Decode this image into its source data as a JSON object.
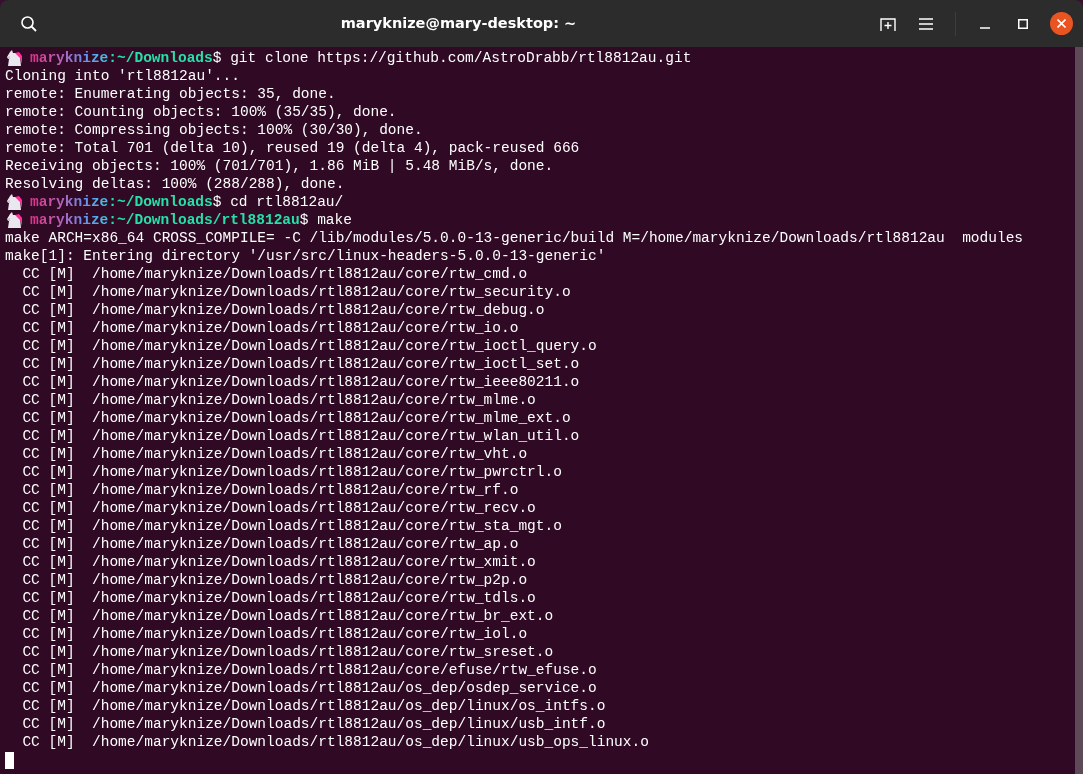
{
  "window": {
    "title": "maryknize@mary-desktop: ~"
  },
  "lines": [
    {
      "kind": "prompt",
      "user": "maryknize",
      "path": ":~/Downloads",
      "command": "$ git clone https://github.com/AstroDrabb/rtl8812au.git"
    },
    {
      "kind": "output",
      "text": "Cloning into 'rtl8812au'..."
    },
    {
      "kind": "output",
      "text": "remote: Enumerating objects: 35, done."
    },
    {
      "kind": "output",
      "text": "remote: Counting objects: 100% (35/35), done."
    },
    {
      "kind": "output",
      "text": "remote: Compressing objects: 100% (30/30), done."
    },
    {
      "kind": "output",
      "text": "remote: Total 701 (delta 10), reused 19 (delta 4), pack-reused 666"
    },
    {
      "kind": "output",
      "text": "Receiving objects: 100% (701/701), 1.86 MiB | 5.48 MiB/s, done."
    },
    {
      "kind": "output",
      "text": "Resolving deltas: 100% (288/288), done."
    },
    {
      "kind": "prompt",
      "user": "maryknize",
      "path": ":~/Downloads",
      "command": "$ cd rtl8812au/"
    },
    {
      "kind": "prompt",
      "user": "maryknize",
      "path": ":~/Downloads/rtl8812au",
      "command": "$ make"
    },
    {
      "kind": "output",
      "text": "make ARCH=x86_64 CROSS_COMPILE= -C /lib/modules/5.0.0-13-generic/build M=/home/maryknize/Downloads/rtl8812au  modules"
    },
    {
      "kind": "output",
      "text": "make[1]: Entering directory '/usr/src/linux-headers-5.0.0-13-generic'"
    },
    {
      "kind": "output",
      "text": "  CC [M]  /home/maryknize/Downloads/rtl8812au/core/rtw_cmd.o"
    },
    {
      "kind": "output",
      "text": "  CC [M]  /home/maryknize/Downloads/rtl8812au/core/rtw_security.o"
    },
    {
      "kind": "output",
      "text": "  CC [M]  /home/maryknize/Downloads/rtl8812au/core/rtw_debug.o"
    },
    {
      "kind": "output",
      "text": "  CC [M]  /home/maryknize/Downloads/rtl8812au/core/rtw_io.o"
    },
    {
      "kind": "output",
      "text": "  CC [M]  /home/maryknize/Downloads/rtl8812au/core/rtw_ioctl_query.o"
    },
    {
      "kind": "output",
      "text": "  CC [M]  /home/maryknize/Downloads/rtl8812au/core/rtw_ioctl_set.o"
    },
    {
      "kind": "output",
      "text": "  CC [M]  /home/maryknize/Downloads/rtl8812au/core/rtw_ieee80211.o"
    },
    {
      "kind": "output",
      "text": "  CC [M]  /home/maryknize/Downloads/rtl8812au/core/rtw_mlme.o"
    },
    {
      "kind": "output",
      "text": "  CC [M]  /home/maryknize/Downloads/rtl8812au/core/rtw_mlme_ext.o"
    },
    {
      "kind": "output",
      "text": "  CC [M]  /home/maryknize/Downloads/rtl8812au/core/rtw_wlan_util.o"
    },
    {
      "kind": "output",
      "text": "  CC [M]  /home/maryknize/Downloads/rtl8812au/core/rtw_vht.o"
    },
    {
      "kind": "output",
      "text": "  CC [M]  /home/maryknize/Downloads/rtl8812au/core/rtw_pwrctrl.o"
    },
    {
      "kind": "output",
      "text": "  CC [M]  /home/maryknize/Downloads/rtl8812au/core/rtw_rf.o"
    },
    {
      "kind": "output",
      "text": "  CC [M]  /home/maryknize/Downloads/rtl8812au/core/rtw_recv.o"
    },
    {
      "kind": "output",
      "text": "  CC [M]  /home/maryknize/Downloads/rtl8812au/core/rtw_sta_mgt.o"
    },
    {
      "kind": "output",
      "text": "  CC [M]  /home/maryknize/Downloads/rtl8812au/core/rtw_ap.o"
    },
    {
      "kind": "output",
      "text": "  CC [M]  /home/maryknize/Downloads/rtl8812au/core/rtw_xmit.o"
    },
    {
      "kind": "output",
      "text": "  CC [M]  /home/maryknize/Downloads/rtl8812au/core/rtw_p2p.o"
    },
    {
      "kind": "output",
      "text": "  CC [M]  /home/maryknize/Downloads/rtl8812au/core/rtw_tdls.o"
    },
    {
      "kind": "output",
      "text": "  CC [M]  /home/maryknize/Downloads/rtl8812au/core/rtw_br_ext.o"
    },
    {
      "kind": "output",
      "text": "  CC [M]  /home/maryknize/Downloads/rtl8812au/core/rtw_iol.o"
    },
    {
      "kind": "output",
      "text": "  CC [M]  /home/maryknize/Downloads/rtl8812au/core/rtw_sreset.o"
    },
    {
      "kind": "output",
      "text": "  CC [M]  /home/maryknize/Downloads/rtl8812au/core/efuse/rtw_efuse.o"
    },
    {
      "kind": "output",
      "text": "  CC [M]  /home/maryknize/Downloads/rtl8812au/os_dep/osdep_service.o"
    },
    {
      "kind": "output",
      "text": "  CC [M]  /home/maryknize/Downloads/rtl8812au/os_dep/linux/os_intfs.o"
    },
    {
      "kind": "output",
      "text": "  CC [M]  /home/maryknize/Downloads/rtl8812au/os_dep/linux/usb_intf.o"
    },
    {
      "kind": "output",
      "text": "  CC [M]  /home/maryknize/Downloads/rtl8812au/os_dep/linux/usb_ops_linux.o"
    }
  ]
}
